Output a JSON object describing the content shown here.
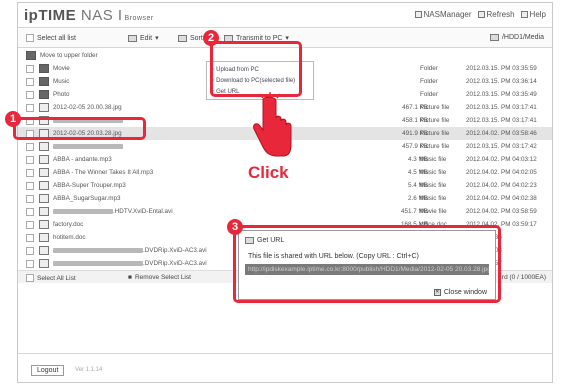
{
  "header": {
    "brand_a": "ip",
    "brand_b": "TIME",
    "brand_c": " NAS I",
    "brand_sub": "Browser",
    "links": [
      "NASManager",
      "Refresh",
      "Help"
    ]
  },
  "toolbar": {
    "select_all": "Select all list",
    "edit": "Edit",
    "sort": "Sort",
    "transmit": "Transmit to PC",
    "path": "/HDD1/Media"
  },
  "transmit_menu": [
    "Upload from PC",
    "Download to PC(selected file)",
    "Get URL"
  ],
  "files": [
    {
      "name": "Move to upper folder",
      "size": "",
      "type": "",
      "date": ""
    },
    {
      "name": "Movie",
      "size": "",
      "type": "Folder",
      "date": "2012.03.15. PM 03:35:59"
    },
    {
      "name": "Music",
      "size": "",
      "type": "Folder",
      "date": "2012.03.15. PM 03:36:14"
    },
    {
      "name": "Photo",
      "size": "",
      "type": "Folder",
      "date": "2012.03.15. PM 03:35:49"
    },
    {
      "name": "2012-02-05 20.00.38.jpg",
      "size": "467.1 KB",
      "type": "Picture file",
      "date": "2012.03.15. PM 03:17:41"
    },
    {
      "name": "",
      "size": "458.1 KB",
      "type": "Picture file",
      "date": "2012.03.15. PM 03:17:41"
    },
    {
      "name": "2012-02-05 20.03.28.jpg",
      "size": "491.9 KB",
      "type": "Picture file",
      "date": "2012.04.02. PM 03:58:46"
    },
    {
      "name": "",
      "size": "457.9 KB",
      "type": "Picture file",
      "date": "2012.03.15. PM 03:17:42"
    },
    {
      "name": "ABBA - andante.mp3",
      "size": "4.3 MB",
      "type": "Music file",
      "date": "2012.04.02. PM 04:03:12"
    },
    {
      "name": "ABBA - The Winner Takes It All.mp3",
      "size": "4.5 MB",
      "type": "Music file",
      "date": "2012.04.02. PM 04:02:05"
    },
    {
      "name": "ABBA-Super Trouper.mp3",
      "size": "5.4 MB",
      "type": "Music file",
      "date": "2012.04.02. PM 04:02:23"
    },
    {
      "name": "ABBA_SugarSugar.mp3",
      "size": "2.6 MB",
      "type": "Music file",
      "date": "2012.04.02. PM 04:02:38"
    },
    {
      "name": ".HDTV.XviD-Ental.avi",
      "size": "451.7 MB",
      "type": "Movie file",
      "date": "2012.04.02. PM 03:58:59"
    },
    {
      "name": "factory.doc",
      "size": "168.5 MB",
      "type": "office doc.",
      "date": "2012.04.02. PM 03:59:17"
    },
    {
      "name": "hotitem.doc",
      "size": "",
      "type": "",
      "date": "PM 03:59:36"
    },
    {
      "name": ".DVDRip.XviD-AC3.avi",
      "size": "",
      "type": "",
      "date": "PM 03:23:03"
    },
    {
      "name": ".DVDRip.XviD-AC3.avi",
      "size": "",
      "type": "",
      "date": "PM 03:25:57"
    }
  ],
  "bottom_bar": {
    "select_all": "Select All List",
    "remove": "Remove Select List",
    "quota": "rd (0 / 1000EA)"
  },
  "dialog": {
    "title": "Get URL",
    "message": "This file is shared with URL below. (Copy URL : Ctrl+C)",
    "url": "http://ipdiskexample.iptime.co.kr:8000/publish/HDD1/Media/2012-02-05 20.03.28.jpg",
    "close": "Close window"
  },
  "footer": {
    "logout": "Logout",
    "version": "Ver 1.1.14"
  },
  "annotations": {
    "step1": "1",
    "step2": "2",
    "step3": "3",
    "click": "Click"
  },
  "colors": {
    "highlight": "#e8283a"
  }
}
